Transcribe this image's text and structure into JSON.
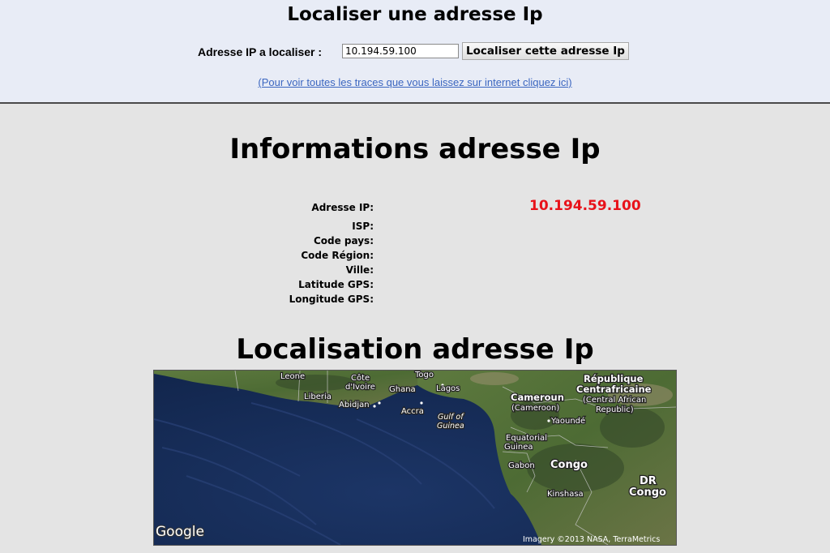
{
  "header": {
    "title": "Localiser une adresse Ip",
    "ip_label": "Adresse IP a localiser :",
    "ip_value": "10.194.59.100",
    "locate_button": "Localiser cette adresse Ip",
    "trace_link": "(Pour voir toutes les traces que vous laissez sur internet cliquez ici)"
  },
  "info": {
    "title": "Informations adresse Ip",
    "fields": {
      "ip": "Adresse IP:",
      "isp": "ISP:",
      "country": "Code pays:",
      "region": "Code Région:",
      "city": "Ville:",
      "lat": "Latitude GPS:",
      "lon": "Longitude GPS:"
    },
    "ip_value": "10.194.59.100",
    "colors": {
      "ip_value": "#e8121a",
      "link": "#3b66c0",
      "header_bg": "#e8ecf6",
      "body_bg": "#e4e4e4"
    }
  },
  "map": {
    "title": "Localisation adresse Ip",
    "labels": {
      "leone": "Leone",
      "cote": "Côte",
      "divoire": "d'Ivoire",
      "togo": "Togo",
      "liberia": "Liberia",
      "abidjan": "Abidjan",
      "ghana": "Ghana",
      "lagos": "Lagos",
      "accra": "Accra",
      "gulf": "Gulf of",
      "guinea": "Guinea",
      "rep": "République",
      "centraf": "Centrafricaine",
      "car": "(Central African",
      "republic": "Republic)",
      "cameroun": "Cameroun",
      "cameroon": "(Cameroon)",
      "yaounde": "Yaoundé",
      "eq": "Equatorial",
      "guinee": "Guinea",
      "gabon": "Gabon",
      "congo": "Congo",
      "dr": "DR",
      "drcongo": "Congo",
      "kinshasa": "Kinshasa"
    },
    "logo": "Google",
    "attribution": "Imagery ©2013 NASA, TerraMetrics",
    "icons": [
      "google-logo"
    ]
  }
}
